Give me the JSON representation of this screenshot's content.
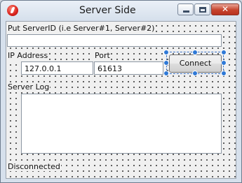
{
  "window": {
    "title": "Server Side",
    "controls": {
      "minimize": "minimize",
      "maximize": "maximize",
      "close": "close"
    }
  },
  "form": {
    "server_id_label": "Put ServerID (i.e Server#1, Server#2)",
    "server_id_value": "",
    "ip_label": "IP Address",
    "ip_value": "127.0.0.1",
    "port_label": "Port",
    "port_value": "61613",
    "connect_label": "Connect",
    "log_label": "Server Log",
    "log_value": "",
    "status": "Disconnected"
  },
  "colors": {
    "close_button": "#c7432d",
    "selection": "#2f79d6",
    "client_background": "#f0f0f0"
  }
}
